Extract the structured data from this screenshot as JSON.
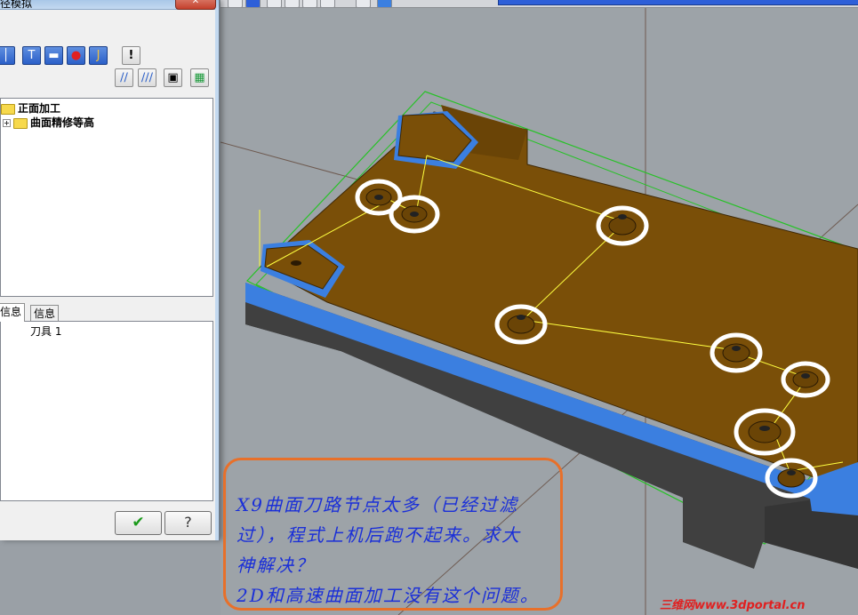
{
  "dialog": {
    "title": "径模拟",
    "close_label": "✕",
    "toolbar_icons": [
      "tool-icon",
      "holder-icon",
      "flat-tool-icon",
      "toolpath-point-icon",
      "tool-shank-icon",
      "warning-icon"
    ],
    "toolbar2_icons": [
      "single-pass-icon",
      "multi-pass-icon",
      "camera-icon",
      "save-icon"
    ],
    "tree": {
      "root": "正面加工",
      "child": "曲面精修等高"
    },
    "tabs": [
      "信息",
      "信息"
    ],
    "info": {
      "tool": "刀具 1"
    },
    "ok_label": "✔",
    "help_label": "?"
  },
  "annotation": {
    "lines": [
      "X9曲面刀路节点太多（已经过滤",
      "过），程式上机后跑不起来。求大",
      "神解决？",
      "2D和高速曲面加工没有这个问题。"
    ]
  },
  "watermark": "三维网www.3dportal.cn",
  "colors": {
    "part_top": "#7a4f08",
    "part_side": "#3a3a3a",
    "highlight_blue": "#3b7fe0",
    "toolpath": "#ffff40",
    "bbox": "#27c227",
    "annotation_border": "#e8702a",
    "annotation_text": "#1a2fd8"
  }
}
